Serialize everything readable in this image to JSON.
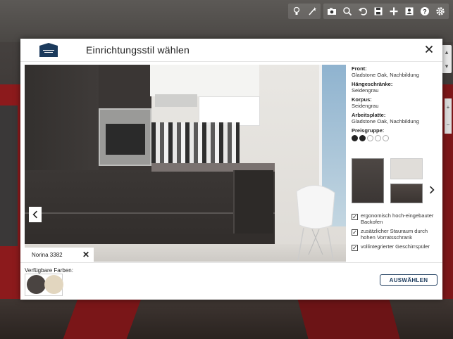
{
  "modal": {
    "title": "Einrichtungsstil wählen",
    "logo_name": "küchen quelle"
  },
  "preview": {
    "label": "Norina 3382"
  },
  "details": {
    "front_label": "Front:",
    "front_value": "Gladstone Oak, Nachbildung",
    "wall_units_label": "Hängeschränke:",
    "wall_units_value": "Seidengrau",
    "carcass_label": "Korpus:",
    "carcass_value": "Seidengrau",
    "worktop_label": "Arbeitsplatte:",
    "worktop_value": "Gladstone Oak, Nachbildung",
    "price_group_label": "Preisgruppe:",
    "price_group": 2,
    "price_group_max": 5
  },
  "features": [
    {
      "text": "ergonomisch hoch-eingebauter Backofen",
      "checked": true
    },
    {
      "text": "zusätzlicher Stauraum durch hohen Vorratsschrank",
      "checked": true
    },
    {
      "text": "vollintegrierter Geschirrspüler",
      "checked": true
    }
  ],
  "footer": {
    "colors_label": "Verfügbare Farben:",
    "color_options": [
      "#4a4441",
      "#e2d6bf"
    ],
    "select_label": "AUSWÄHLEN"
  },
  "colors": {
    "accent": "#1b3a5c"
  }
}
